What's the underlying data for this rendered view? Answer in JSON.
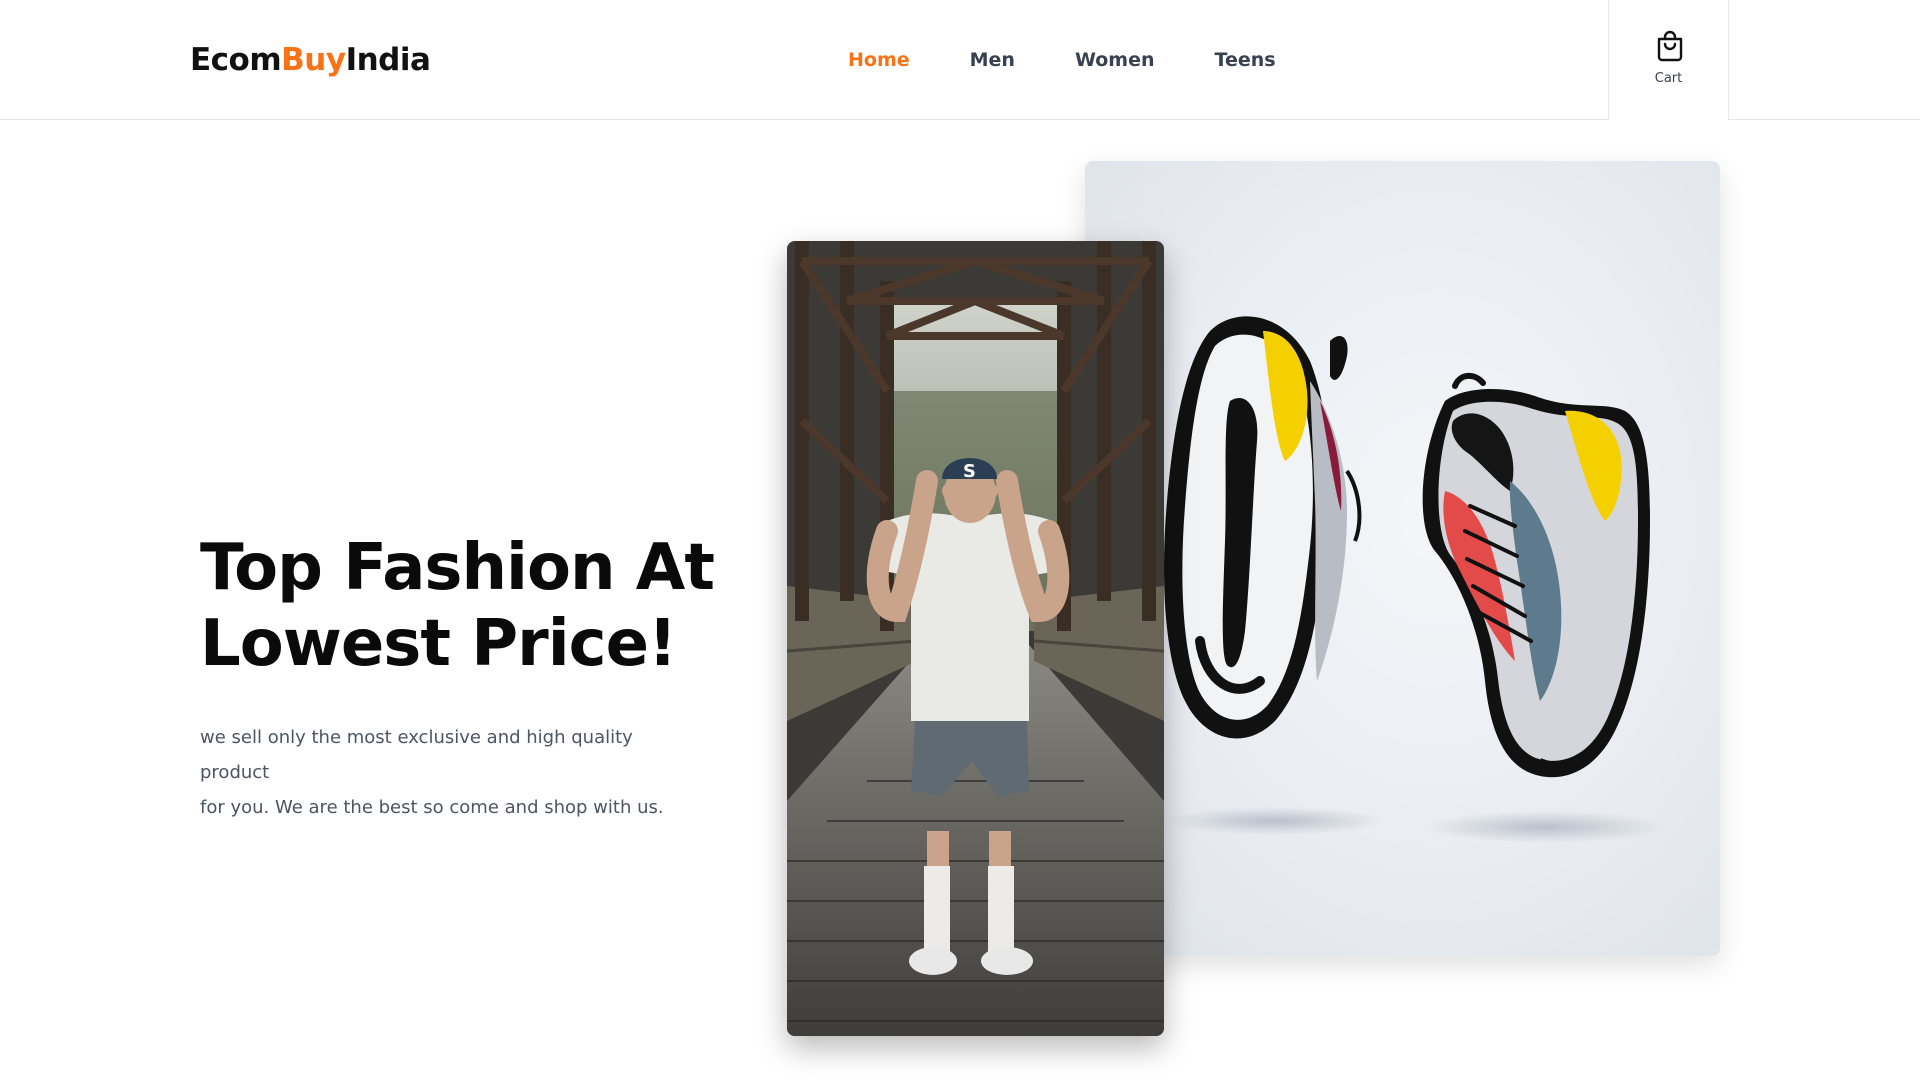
{
  "brand": {
    "part1": "Ecom",
    "part2": "Buy",
    "part3": "India",
    "accent_color": "#f97316"
  },
  "nav": {
    "items": [
      {
        "label": "Home",
        "active": true
      },
      {
        "label": "Men",
        "active": false
      },
      {
        "label": "Women",
        "active": false
      },
      {
        "label": "Teens",
        "active": false
      }
    ]
  },
  "cart": {
    "label": "Cart",
    "icon": "shopping-bag-icon"
  },
  "hero": {
    "title_line1": "Top Fashion At",
    "title_line2": "Lowest Price!",
    "description_line1": "we sell only the most exclusive and high quality product",
    "description_line2": "for you. We are the best so come and shop with us."
  },
  "images": {
    "person": "person-on-bridge-photo",
    "shoes": "sneakers-photo"
  }
}
